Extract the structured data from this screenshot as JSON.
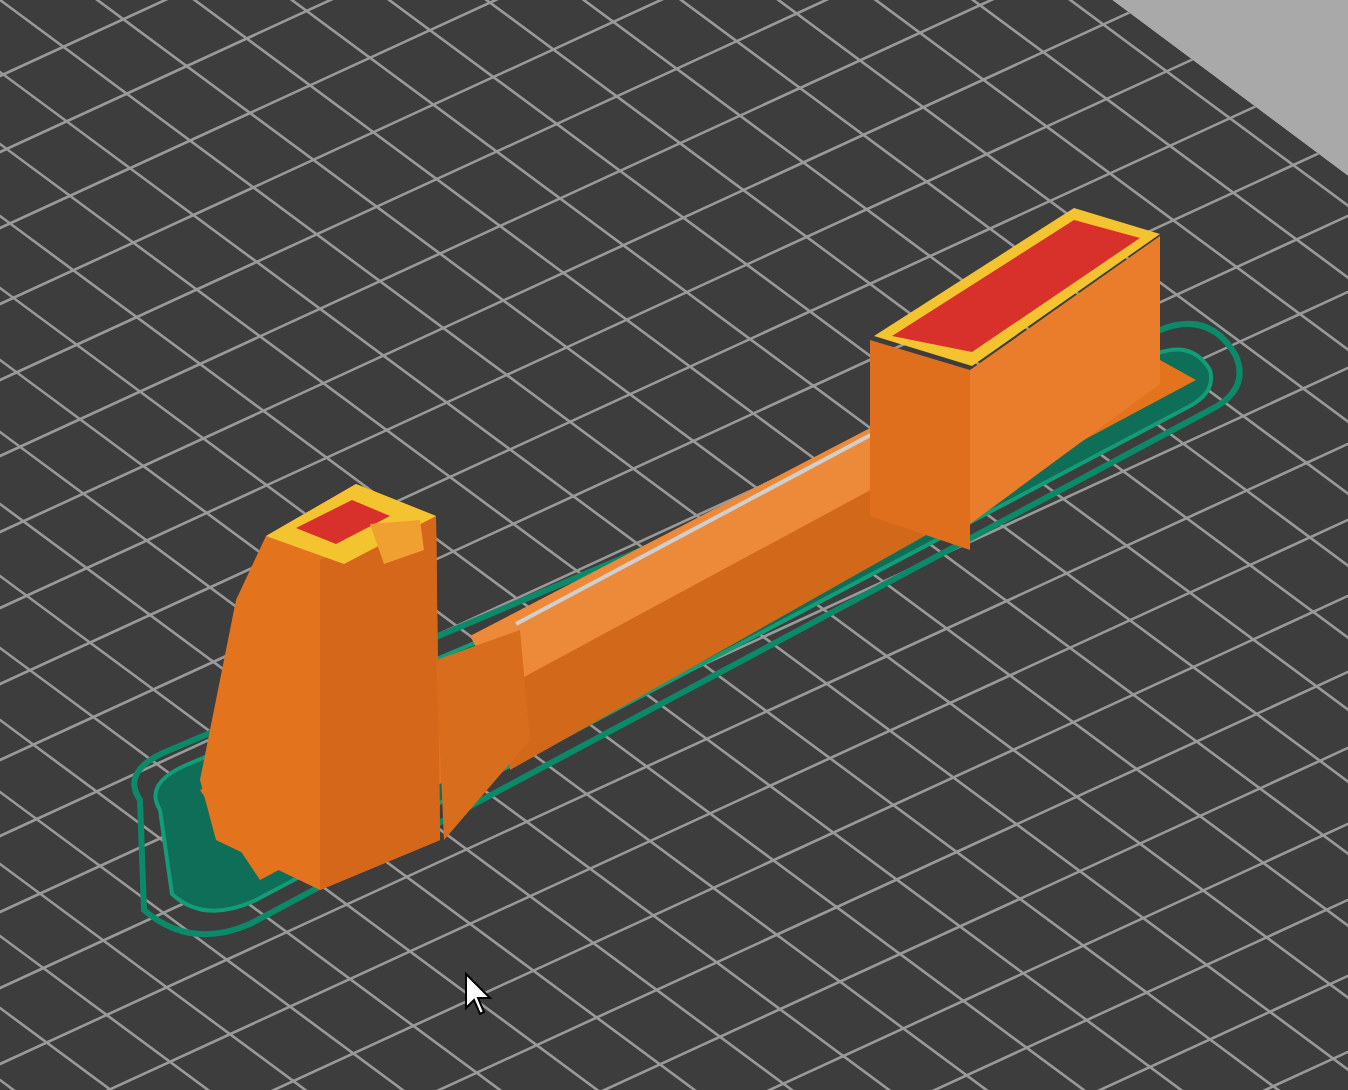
{
  "preview": {
    "kind": "sliced-model"
  }
}
